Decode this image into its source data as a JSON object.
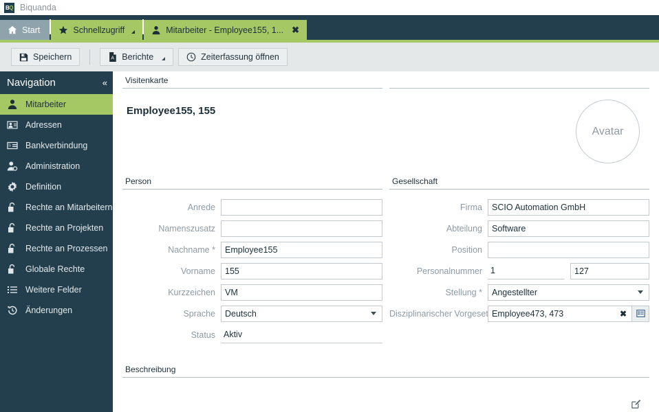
{
  "window": {
    "app_title": "Biquanda",
    "logo_text": "BQ"
  },
  "colors": {
    "navy": "#233f4d",
    "green": "#a6c864",
    "toolbar_bg": "#e4e8e9",
    "tab_home_bg": "#8fa3ad",
    "label_gray": "#8e9aa3"
  },
  "tabs": [
    {
      "label": "Start",
      "icon": "home-icon",
      "state": "inactive"
    },
    {
      "label": "Schnellzugriff",
      "icon": "star-icon",
      "state": "active",
      "has_caret": true
    },
    {
      "label": "Mitarbeiter - Employee155, 1...",
      "icon": "person-icon",
      "state": "active",
      "closable": true,
      "close_glyph": "✖"
    }
  ],
  "toolbar": {
    "save_label": "Speichern",
    "reports_label": "Berichte",
    "timetracking_label": "Zeiterfassung öffnen"
  },
  "sidebar": {
    "title": "Navigation",
    "collapse_glyph": "«",
    "items": [
      {
        "label": "Mitarbeiter",
        "icon": "person-icon",
        "active": true
      },
      {
        "label": "Adressen",
        "icon": "address-icon",
        "active": false
      },
      {
        "label": "Bankverbindung",
        "icon": "bank-card-icon",
        "active": false
      },
      {
        "label": "Administration",
        "icon": "person-gear-icon",
        "active": false
      },
      {
        "label": "Definition",
        "icon": "gear-icon",
        "active": false
      },
      {
        "label": "Rechte an Mitarbeitern",
        "icon": "lock-open-icon",
        "active": false
      },
      {
        "label": "Rechte an Projekten",
        "icon": "lock-open-icon",
        "active": false
      },
      {
        "label": "Rechte an Prozessen",
        "icon": "lock-open-icon",
        "active": false
      },
      {
        "label": "Globale Rechte",
        "icon": "lock-open-icon",
        "active": false
      },
      {
        "label": "Weitere Felder",
        "icon": "list-icon",
        "active": false
      },
      {
        "label": "Änderungen",
        "icon": "history-icon",
        "active": false
      }
    ]
  },
  "main": {
    "visitenkarte": {
      "section_title": "Visitenkarte",
      "display_name": "Employee155, 155",
      "avatar_label": "Avatar"
    },
    "person": {
      "section_title": "Person",
      "fields": [
        {
          "label": "Anrede",
          "value": "",
          "type": "input"
        },
        {
          "label": "Namenszusatz",
          "value": "",
          "type": "input"
        },
        {
          "label": "Nachname",
          "required": true,
          "value": "Employee155",
          "type": "input"
        },
        {
          "label": "Vorname",
          "value": "155",
          "type": "input"
        },
        {
          "label": "Kurzzeichen",
          "value": "VM",
          "type": "input"
        },
        {
          "label": "Sprache",
          "value": "Deutsch",
          "type": "select"
        },
        {
          "label": "Status",
          "value": "Aktiv",
          "type": "readonly"
        }
      ]
    },
    "gesellschaft": {
      "section_title": "Gesellschaft",
      "fields": [
        {
          "label": "Firma",
          "value": "SCIO Automation GmbH",
          "type": "input"
        },
        {
          "label": "Abteilung",
          "value": "Software",
          "type": "input"
        },
        {
          "label": "Position",
          "value": "",
          "type": "input"
        },
        {
          "label": "Personalnummer",
          "value": "1",
          "value2": "127",
          "type": "split"
        },
        {
          "label": "Stellung",
          "required": true,
          "value": "Angestellter",
          "type": "select"
        },
        {
          "label": "Disziplinarischer Vorgesetzter",
          "value": "Employee473, 473",
          "type": "lookup",
          "clear_glyph": "✖"
        }
      ]
    },
    "beschreibung": {
      "section_title": "Beschreibung",
      "value": ""
    }
  }
}
